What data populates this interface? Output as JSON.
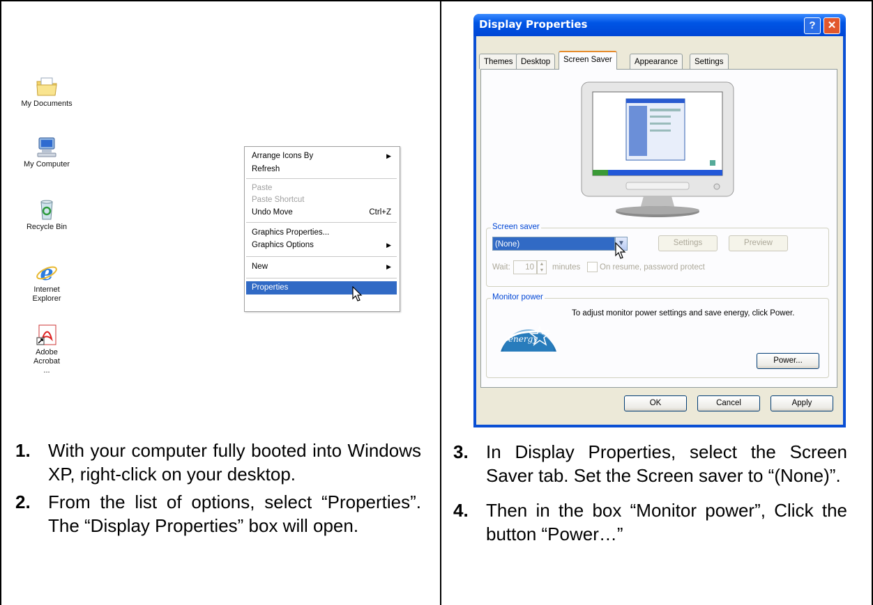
{
  "desktop": {
    "icons": [
      {
        "label": "My Documents",
        "icon": "folder-documents-icon"
      },
      {
        "label": "My Computer",
        "icon": "computer-icon"
      },
      {
        "label": "Recycle Bin",
        "icon": "recycle-bin-icon"
      },
      {
        "label": "Internet Explorer",
        "icon": "internet-explorer-icon"
      },
      {
        "label": "Adobe Acrobat ...",
        "icon": "adobe-acrobat-icon"
      }
    ]
  },
  "context_menu": {
    "items": [
      {
        "label": "Arrange Icons By",
        "submenu": true
      },
      {
        "label": "Refresh"
      },
      {
        "label": "Paste",
        "disabled": true
      },
      {
        "label": "Paste Shortcut",
        "disabled": true
      },
      {
        "label": "Undo Move",
        "shortcut": "Ctrl+Z"
      },
      {
        "label": "Graphics Properties..."
      },
      {
        "label": "Graphics Options",
        "submenu": true
      },
      {
        "label": "New",
        "submenu": true
      },
      {
        "label": "Properties",
        "selected": true
      }
    ]
  },
  "dialog": {
    "title": "Display Properties",
    "help_label": "?",
    "close_label": "✕",
    "tabs": [
      "Themes",
      "Desktop",
      "Screen Saver",
      "Appearance",
      "Settings"
    ],
    "active_tab": "Screen Saver",
    "screen_saver": {
      "group_label": "Screen saver",
      "selected": "(None)",
      "settings_label": "Settings",
      "preview_label": "Preview",
      "wait_label": "Wait:",
      "wait_value": "10",
      "minutes_label": "minutes",
      "resume_label": "On resume, password protect"
    },
    "monitor_power": {
      "group_label": "Monitor power",
      "description": "To adjust monitor power settings and save energy, click Power.",
      "power_label": "Power..."
    },
    "ok_label": "OK",
    "cancel_label": "Cancel",
    "apply_label": "Apply"
  },
  "steps": [
    {
      "num": "1.",
      "text": "With your computer fully booted into Windows XP, right-click on your desktop."
    },
    {
      "num": "2.",
      "text": "From the list of options, select “Properties”. The “Display Properties” box will open."
    },
    {
      "num": "3.",
      "text": "In Display Properties, select the Screen Saver tab. Set the Screen saver to “(None)”."
    },
    {
      "num": "4.",
      "text": "Then in the box “Monitor power”, Click the button “Power…”"
    }
  ]
}
